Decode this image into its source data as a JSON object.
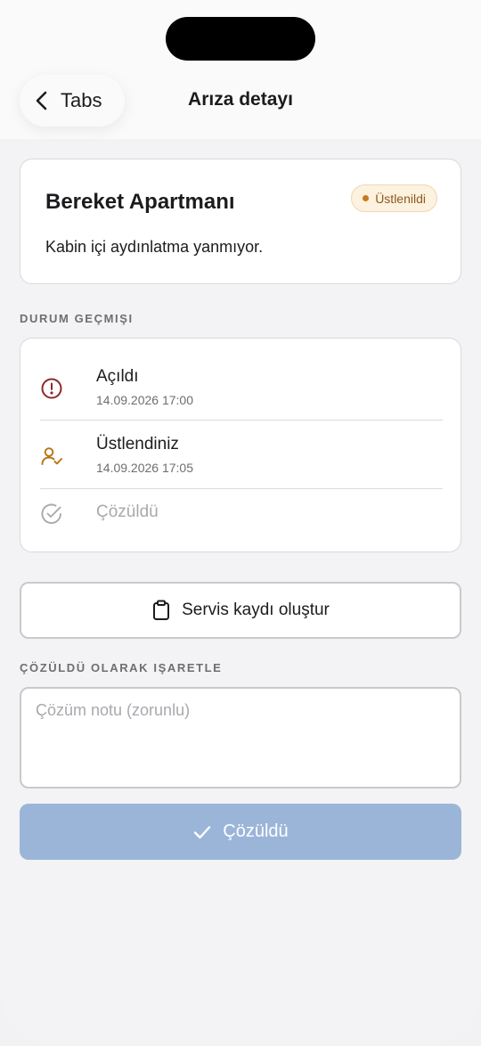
{
  "nav": {
    "back_label": "Tabs",
    "title": "Arıza detayı"
  },
  "fault": {
    "building": "Bereket Apartmanı",
    "description": "Kabin içi aydınlatma yanmıyor.",
    "status_badge": "Üstlenildi",
    "badge_color": "#c77a1a"
  },
  "history": {
    "section_label": "DURUM GEÇMIŞI",
    "items": [
      {
        "title": "Açıldı",
        "timestamp": "14.09.2026 17:00",
        "icon": "alert-circle-icon",
        "state": "done"
      },
      {
        "title": "Üstlendiniz",
        "timestamp": "14.09.2026 17:05",
        "icon": "user-check-icon",
        "state": "done"
      },
      {
        "title": "Çözüldü",
        "timestamp": "",
        "icon": "check-circle-icon",
        "state": "pending"
      }
    ]
  },
  "actions": {
    "service_record_label": "Servis kaydı oluştur",
    "resolve_section_label": "ÇÖZÜLDÜ OLARAK IŞARETLE",
    "note_placeholder": "Çözüm notu (zorunlu)",
    "note_value": "",
    "resolve_button_label": "Çözüldü",
    "resolve_button_color": "#9bb5d9"
  }
}
